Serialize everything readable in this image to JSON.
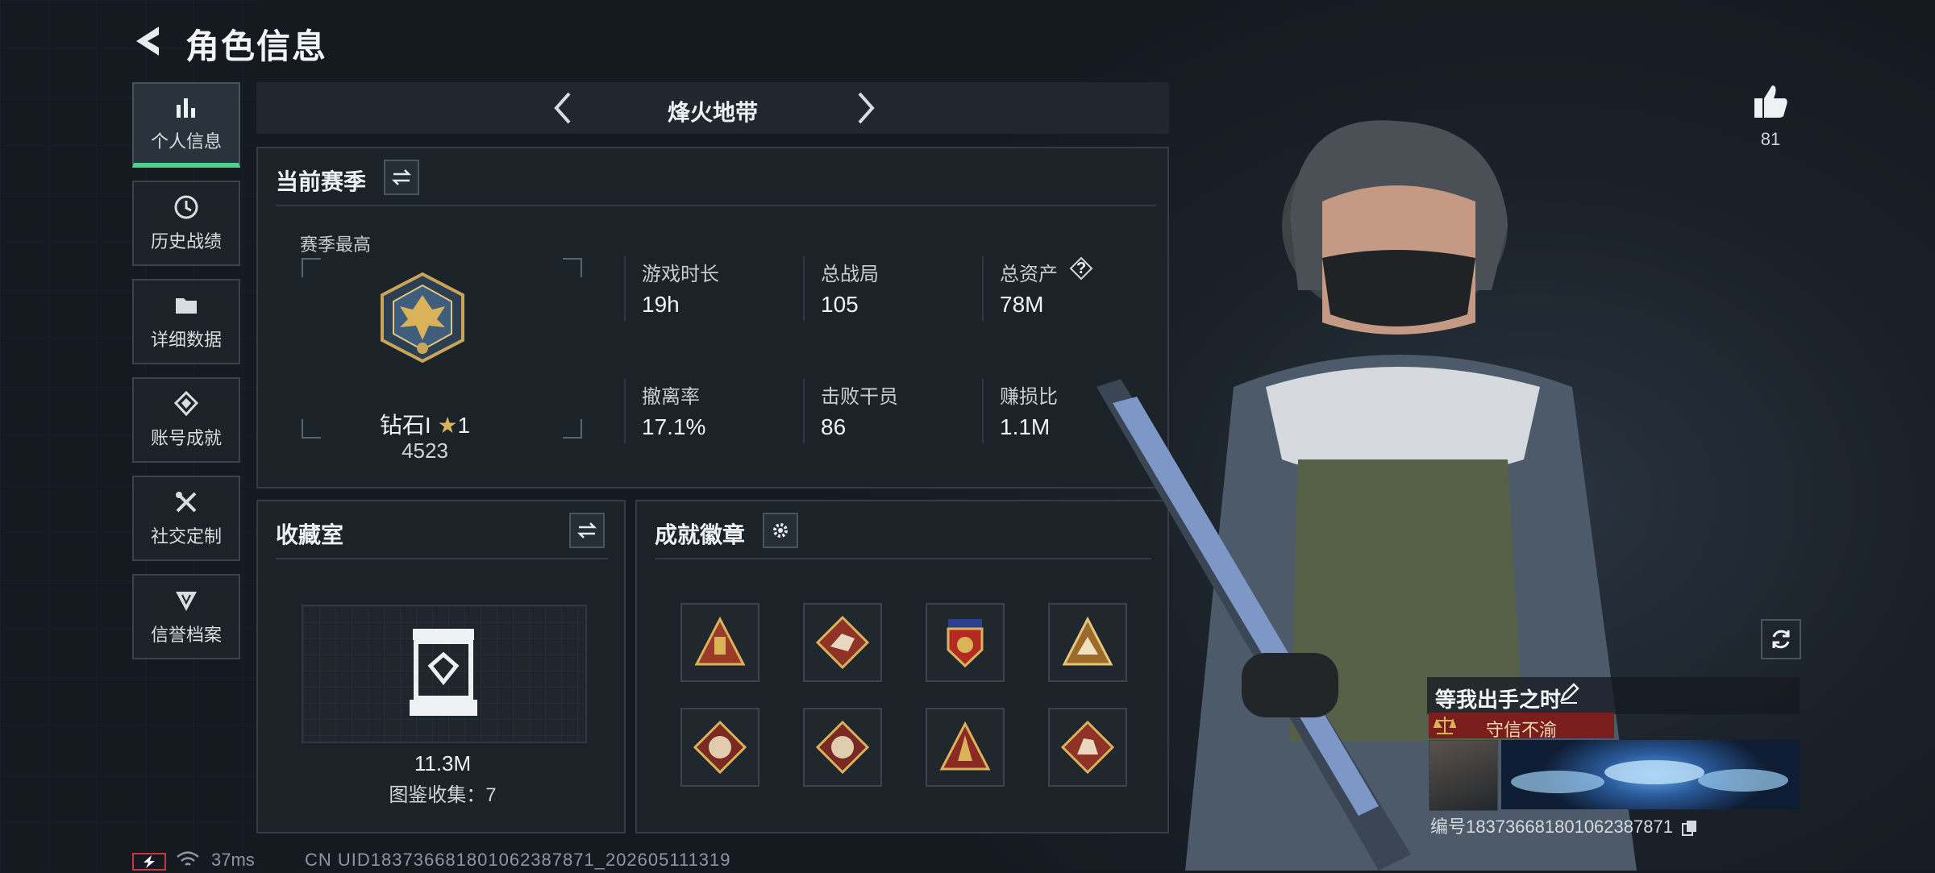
{
  "header": {
    "title": "角色信息"
  },
  "sidebar": {
    "items": [
      {
        "label": "个人信息",
        "icon": "bar-chart-icon",
        "active": true
      },
      {
        "label": "历史战绩",
        "icon": "clock-icon"
      },
      {
        "label": "详细数据",
        "icon": "folder-icon"
      },
      {
        "label": "账号成就",
        "icon": "achievement-icon"
      },
      {
        "label": "社交定制",
        "icon": "tools-icon"
      },
      {
        "label": "信誉档案",
        "icon": "shield-icon"
      }
    ]
  },
  "mode_selector": {
    "name": "烽火地带"
  },
  "season": {
    "title": "当前赛季",
    "best_label": "赛季最高",
    "rank_name": "钻石I",
    "rank_stars": "1",
    "rank_score": "4523",
    "stats": [
      {
        "label": "游戏时长",
        "value": "19h"
      },
      {
        "label": "总战局",
        "value": "105"
      },
      {
        "label": "总资产",
        "value": "78M"
      },
      {
        "label": "撤离率",
        "value": "17.1%"
      },
      {
        "label": "击败干员",
        "value": "86"
      },
      {
        "label": "赚损比",
        "value": "1.1M"
      }
    ],
    "help_icon": "?"
  },
  "collection": {
    "title": "收藏室",
    "value": "11.3M",
    "count_text": "图鉴收集：7"
  },
  "achievements": {
    "title": "成就徽章",
    "badge_count": 8
  },
  "likes": {
    "count": "81"
  },
  "profile_card": {
    "nickname": "等我出手之时",
    "tag": "守信不渝",
    "id_text": "编号183736681801062387871"
  },
  "status_bar": {
    "ping": "37ms",
    "uid": "CN UID183736681801062387871_202605111319"
  },
  "colors": {
    "accent": "#4fd18c",
    "tag_bg": "#7a1d1d",
    "gold": "#d9b25a"
  }
}
